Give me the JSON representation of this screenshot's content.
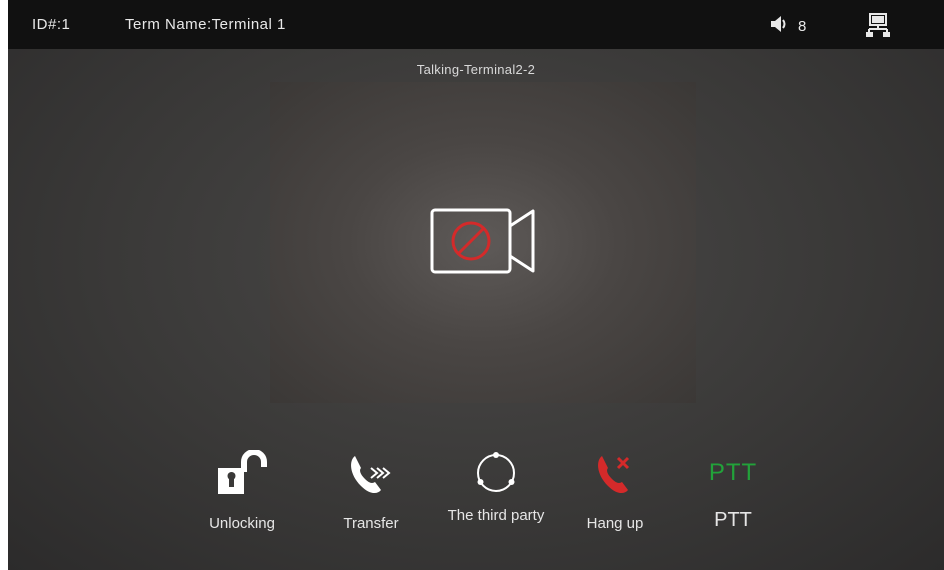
{
  "statusbar": {
    "id": "ID#:1",
    "term_name": "Term Name:Terminal 1",
    "volume": "8"
  },
  "call": {
    "status": "Talking-Terminal2-2"
  },
  "actions": {
    "unlock": "Unlocking",
    "transfer": "Transfer",
    "third_party": "The third party",
    "hangup": "Hang up",
    "ptt_mark": "PTT",
    "ptt": "PTT"
  },
  "colors": {
    "ptt_green": "#22a23a",
    "hangup_red": "#d42a2a",
    "no_video_red": "#d42a2a"
  }
}
